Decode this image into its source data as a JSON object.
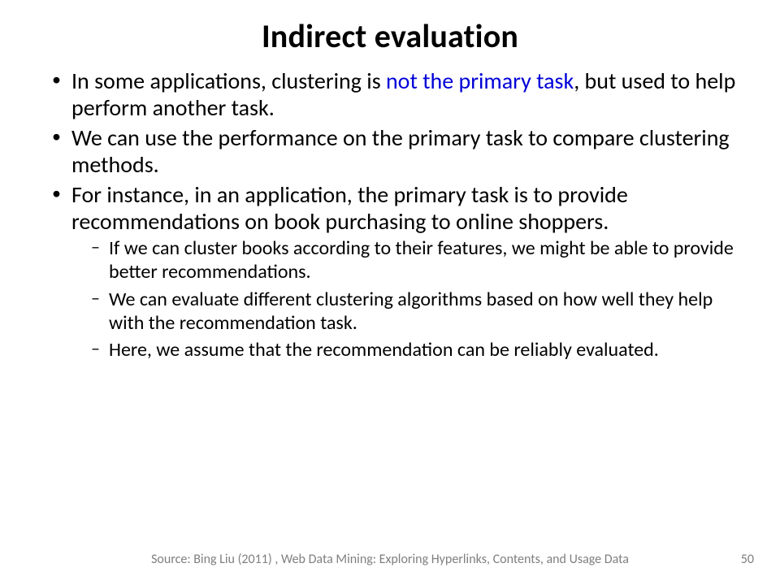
{
  "title": "Indirect evaluation",
  "bullets": [
    {
      "pre": "In some applications, clustering is ",
      "hl": "not the primary task",
      "post": ", but used to help perform another task."
    },
    {
      "text": "We can use the performance on the primary task to compare clustering methods."
    },
    {
      "text": "For instance, in an application, the primary task is to provide recommendations on book purchasing to online shoppers.",
      "sub": [
        "If we can cluster books according to their features, we might be able to provide better recommendations.",
        "We can evaluate different clustering algorithms based on how well they help with the recommendation task.",
        "Here, we assume that the recommendation can be reliably evaluated."
      ]
    }
  ],
  "footer": "Source: Bing Liu (2011) , Web Data Mining: Exploring Hyperlinks, Contents, and Usage Data",
  "page": "50"
}
